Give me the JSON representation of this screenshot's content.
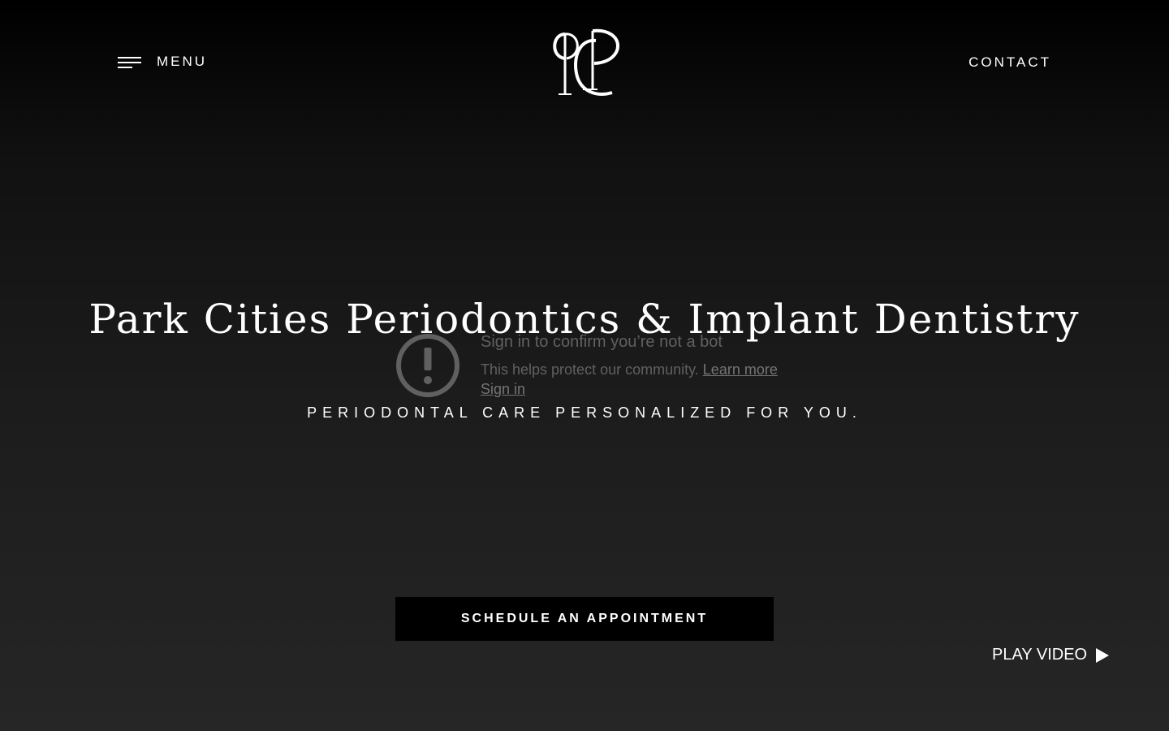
{
  "header": {
    "menu_label": "MENU",
    "contact_label": "CONTACT",
    "logo_icon": "pcp-monogram-logo"
  },
  "hero": {
    "title": "Park Cities Periodontics & Implant Dentistry",
    "subtitle": "PERIODONTAL CARE PERSONALIZED FOR YOU."
  },
  "overlay": {
    "icon": "exclamation-circle-icon",
    "title": "Sign in to confirm you’re not a bot",
    "description": "This helps protect our community.",
    "learn_more": "Learn more",
    "sign_in": "Sign in"
  },
  "cta": {
    "label": "SCHEDULE AN APPOINTMENT"
  },
  "video": {
    "label": "PLAY VIDEO",
    "icon": "play-icon"
  },
  "colors": {
    "background_top": "#000000",
    "background_bottom": "#262626",
    "text": "#ffffff",
    "button_bg": "#000000"
  }
}
